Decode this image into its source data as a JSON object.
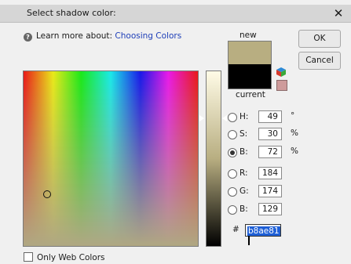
{
  "dialog": {
    "title": "Select shadow color:",
    "close_glyph": "✕"
  },
  "help": {
    "prefix": "Learn more about:",
    "link_text": "Choosing Colors"
  },
  "preview": {
    "new_label": "new",
    "current_label": "current",
    "new_color": "#b8ae81",
    "current_color": "#000000"
  },
  "buttons": {
    "ok": "OK",
    "cancel": "Cancel"
  },
  "hsb": [
    {
      "label": "H:",
      "value": "49",
      "unit": "°",
      "checked": false
    },
    {
      "label": "S:",
      "value": "30",
      "unit": "%",
      "checked": false
    },
    {
      "label": "B:",
      "value": "72",
      "unit": "%",
      "checked": true
    }
  ],
  "rgb": [
    {
      "label": "R:",
      "value": "184"
    },
    {
      "label": "G:",
      "value": "174"
    },
    {
      "label": "B:",
      "value": "129"
    }
  ],
  "hex": {
    "prefix": "#",
    "value": "b8ae81"
  },
  "web_colors": {
    "label": "Only Web Colors",
    "checked": false
  }
}
